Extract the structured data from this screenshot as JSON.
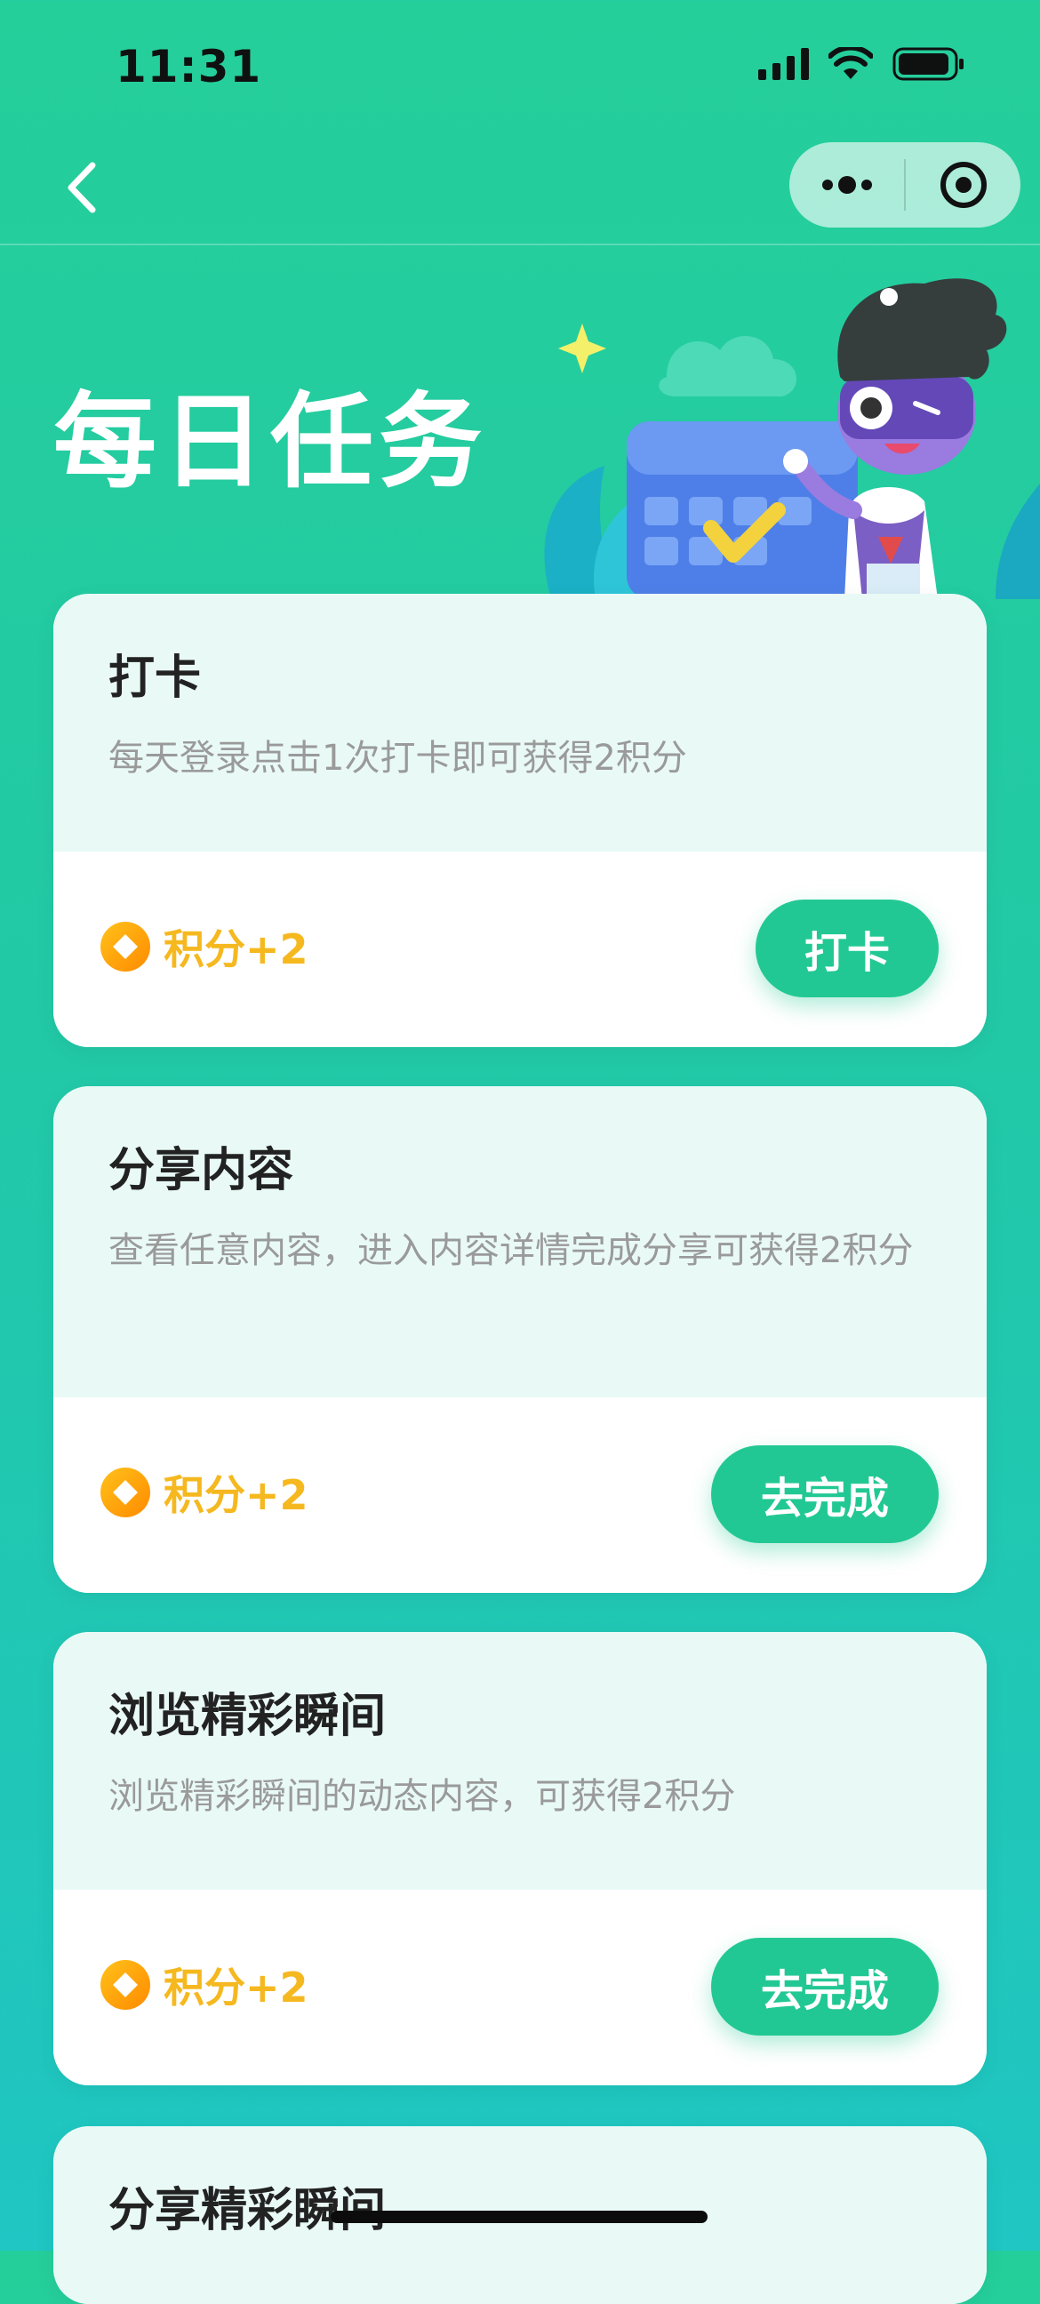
{
  "status_bar": {
    "time": "11:31"
  },
  "page": {
    "title": "每日任务"
  },
  "tasks": [
    {
      "title": "打卡",
      "description": "每天登录点击1次打卡即可获得2积分",
      "points": "积分+2",
      "button": "打卡"
    },
    {
      "title": "分享内容",
      "description": "查看任意内容，进入内容详情完成分享可获得2积分",
      "points": "积分+2",
      "button": "去完成"
    },
    {
      "title": "浏览精彩瞬间",
      "description": "浏览精彩瞬间的动态内容，可获得2积分",
      "points": "积分+2",
      "button": "去完成"
    },
    {
      "title": "分享精彩瞬间"
    }
  ],
  "colors": {
    "accent": "#22c893",
    "points": "#f5b81f",
    "card_header": "#e9faf6"
  },
  "icons": [
    "back-arrow-icon",
    "more-dots-icon",
    "close-target-icon",
    "coin-icon",
    "signal-icon",
    "wifi-icon",
    "battery-icon"
  ]
}
